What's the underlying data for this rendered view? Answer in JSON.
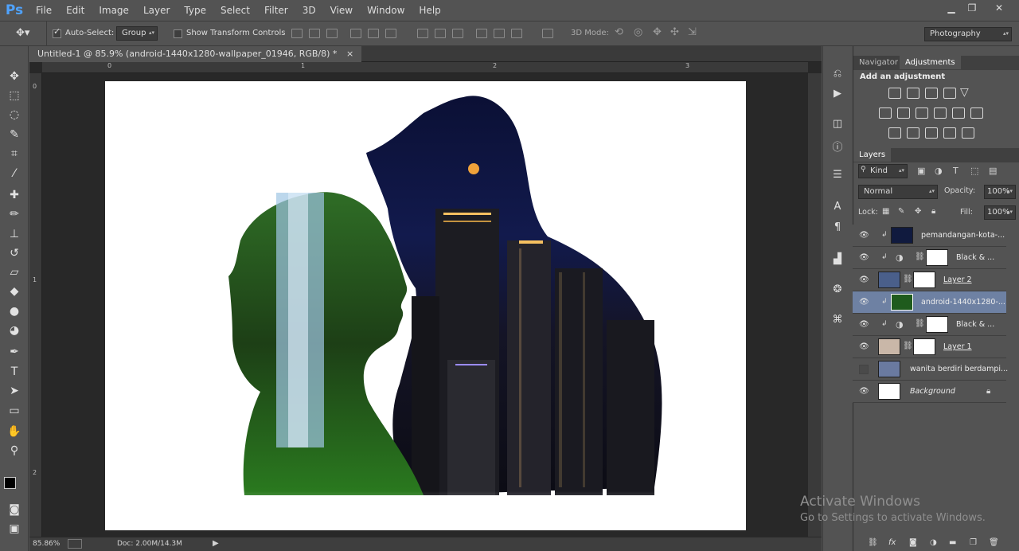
{
  "app": {
    "logo": "Ps"
  },
  "menu": {
    "items": [
      "File",
      "Edit",
      "Image",
      "Layer",
      "Type",
      "Select",
      "Filter",
      "3D",
      "View",
      "Window",
      "Help"
    ]
  },
  "window_controls": [
    "minimize-icon",
    "restore-icon",
    "close-icon"
  ],
  "options_bar": {
    "auto_select_label": "Auto-Select:",
    "auto_select_value": "Group",
    "show_transform_label": "Show Transform Controls",
    "mode_3d_label": "3D Mode:",
    "workspace": "Photography"
  },
  "document": {
    "tab_title": "Untitled-1 @ 85.9% (android-1440x1280-wallpaper_01946, RGB/8) *",
    "tab_close": "×"
  },
  "rulers": {
    "top_marks": [
      "0",
      "1",
      "2",
      "3"
    ],
    "left_marks": [
      "0",
      "1",
      "2"
    ]
  },
  "status": {
    "zoom": "85.86%",
    "doc_info": "Doc: 2.00M/14.3M"
  },
  "panels": {
    "tabs_top": {
      "navigator": "Navigator",
      "adjustments": "Adjustments"
    },
    "add_adjustment": "Add an adjustment",
    "layers_tab": "Layers",
    "kind_label": "Kind",
    "blend_mode": "Normal",
    "opacity_label": "Opacity:",
    "opacity_value": "100%",
    "lock_label": "Lock:",
    "fill_label": "Fill:",
    "fill_value": "100%"
  },
  "layers": [
    {
      "name": "pemandangan-kota-...",
      "type": "image-clipped",
      "visible": true,
      "selected": false
    },
    {
      "name": "Black & ...",
      "type": "adjustment",
      "visible": true,
      "selected": false
    },
    {
      "name": "Layer 2",
      "type": "masked",
      "visible": true,
      "selected": false
    },
    {
      "name": "android-1440x1280-...",
      "type": "image-clipped",
      "visible": true,
      "selected": true
    },
    {
      "name": "Black & ...",
      "type": "adjustment",
      "visible": true,
      "selected": false
    },
    {
      "name": "Layer 1",
      "type": "masked",
      "visible": true,
      "selected": false
    },
    {
      "name": "wanita berdiri berdampi...",
      "type": "image",
      "visible": false,
      "selected": false
    },
    {
      "name": "Background",
      "type": "background",
      "visible": true,
      "selected": false
    }
  ],
  "watermark": {
    "line1": "Activate Windows",
    "line2": "Go to Settings to activate Windows."
  },
  "colors": {
    "ui_bg": "#535353",
    "dark": "#282828",
    "selected_layer": "#6e81a3"
  }
}
